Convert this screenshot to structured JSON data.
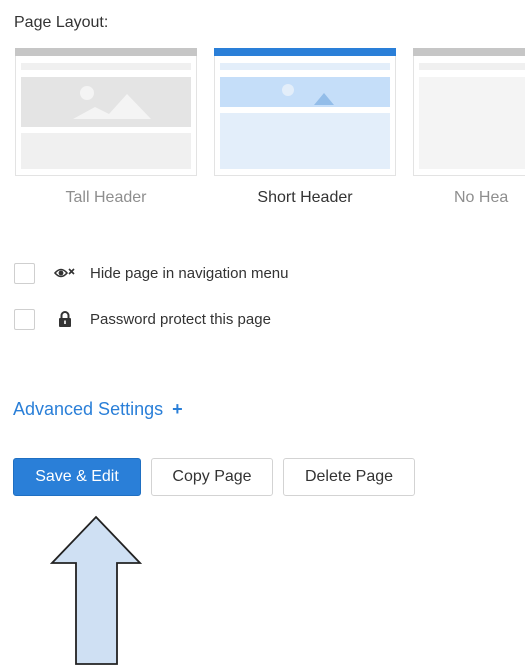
{
  "page_layout": {
    "label": "Page Layout:",
    "options": [
      {
        "name": "Tall Header",
        "selected": false
      },
      {
        "name": "Short Header",
        "selected": true
      },
      {
        "name": "No Hea",
        "selected": false
      }
    ]
  },
  "checkboxes": [
    {
      "label": "Hide page in navigation menu",
      "icon": "hidden-eye-icon",
      "checked": false
    },
    {
      "label": "Password protect this page",
      "icon": "lock-icon",
      "checked": false
    }
  ],
  "advanced_settings": {
    "label": "Advanced Settings",
    "toggle": "+"
  },
  "buttons": {
    "save_edit": "Save & Edit",
    "copy_page": "Copy Page",
    "delete_page": "Delete Page"
  },
  "colors": {
    "accent": "#2a7fd8",
    "selected_fill": "#c5def9",
    "arrow_fill": "#cfe0f3"
  }
}
